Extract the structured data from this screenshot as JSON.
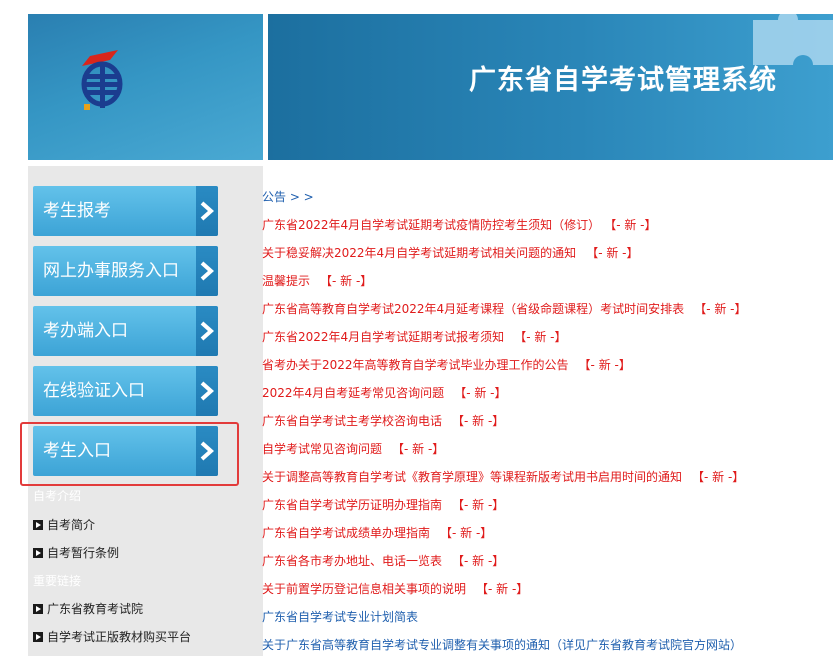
{
  "header": {
    "title": "广东省自学考试管理系统"
  },
  "sidebar": {
    "buttons": [
      {
        "label": "考生报考"
      },
      {
        "label": "网上办事服务入口"
      },
      {
        "label": "考办端入口"
      },
      {
        "label": "在线验证入口"
      },
      {
        "label": "考生入口"
      }
    ],
    "sections": [
      {
        "heading": "自考介绍",
        "links": [
          "自考简介",
          "自考暂行条例"
        ]
      },
      {
        "heading": "重要链接",
        "links": [
          "广东省教育考试院",
          "自学考试正版教材购买平台"
        ]
      }
    ],
    "highlight_color": "#e23b3b"
  },
  "notices": {
    "heading": "公告 > >",
    "new_tag": "【- 新 -】",
    "items": [
      {
        "text": "广东省2022年4月自学考试延期考试疫情防控考生须知（修订）",
        "new": true
      },
      {
        "text": "关于稳妥解决2022年4月自学考试延期考试相关问题的通知",
        "new": true
      },
      {
        "text": "温馨提示",
        "new": true
      },
      {
        "text": "广东省高等教育自学考试2022年4月延考课程（省级命题课程）考试时间安排表",
        "new": true
      },
      {
        "text": "广东省2022年4月自学考试延期考试报考须知",
        "new": true
      },
      {
        "text": "省考办关于2022年高等教育自学考试毕业办理工作的公告",
        "new": true
      },
      {
        "text": "2022年4月自考延考常见咨询问题",
        "new": true
      },
      {
        "text": "广东省自学考试主考学校咨询电话",
        "new": true
      },
      {
        "text": "自学考试常见咨询问题",
        "new": true
      },
      {
        "text": "关于调整高等教育自学考试《教育学原理》等课程新版考试用书启用时间的通知",
        "new": true
      },
      {
        "text": "广东省自学考试学历证明办理指南",
        "new": true
      },
      {
        "text": "广东省自学考试成绩单办理指南",
        "new": true
      },
      {
        "text": "广东省各市考办地址、电话一览表",
        "new": true
      },
      {
        "text": "关于前置学历登记信息相关事项的说明",
        "new": true
      },
      {
        "text": "广东省自学考试专业计划简表",
        "new": false
      },
      {
        "text": "关于广东省高等教育自学考试专业调整有关事项的通知（详见广东省教育考试院官方网站）",
        "new": false
      }
    ]
  }
}
